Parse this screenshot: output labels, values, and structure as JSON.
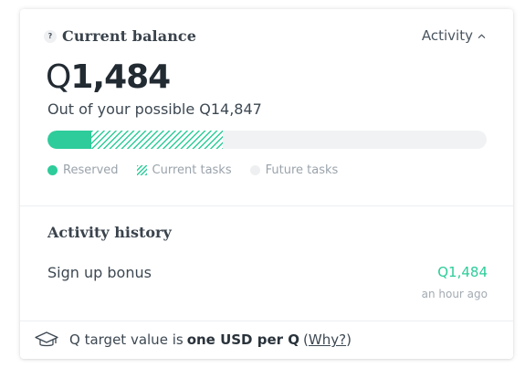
{
  "balance": {
    "title": "Current balance",
    "help_icon_glyph": "?",
    "activity_toggle_label": "Activity",
    "currency_symbol": "Q",
    "amount": "1,484",
    "possible_text": "Out of your possible Q14,847",
    "progress": {
      "reserved_fraction": 0.1,
      "current_fraction": 0.4
    },
    "legend": {
      "reserved": "Reserved",
      "current": "Current tasks",
      "future": "Future tasks"
    }
  },
  "history": {
    "title": "Activity history",
    "items": [
      {
        "label": "Sign up bonus",
        "amount": "Q1,484",
        "time": "an hour ago"
      }
    ]
  },
  "footer": {
    "prefix": "Q target value is",
    "emphasis": "one USD per Q",
    "paren_open": "(",
    "link": "Why?",
    "paren_close": ")"
  },
  "colors": {
    "accent_green": "#2ecc9a",
    "track": "#f1f2f3",
    "text": "#3d4852"
  },
  "icons": {
    "help": "help-circle-icon",
    "chevron": "chevron-up-icon",
    "footer": "graduation-cap-icon"
  }
}
